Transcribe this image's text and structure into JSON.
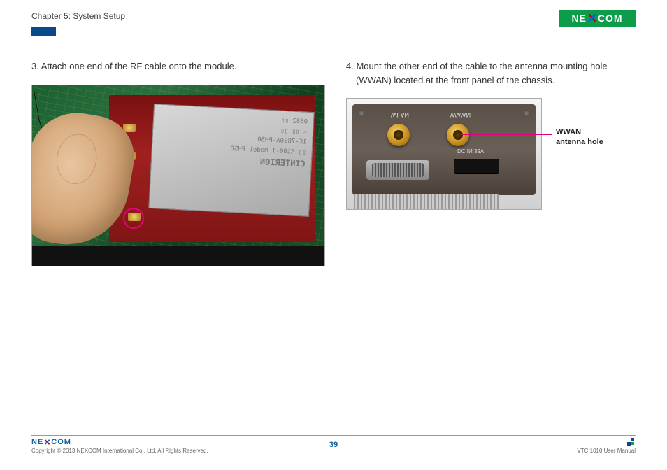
{
  "header": {
    "chapter": "Chapter 5: System Setup",
    "logo_text_left": "NE",
    "logo_text_right": "COM"
  },
  "steps": {
    "s3": "3. Attach one end of the RF cable onto the module.",
    "s4_line1": "4. Mount the other end of the cable to the antenna mounting hole",
    "s4_line2": "(WWAN) located at the front panel of the chassis."
  },
  "fig1": {
    "chip_lines": [
      "0682 ▯▯",
      "⚠ ▯▯ ▯▯",
      "1C-7830A-PH50",
      "▯▯-A100-1 Model PH50",
      "CINTERION"
    ]
  },
  "fig2": {
    "label_wlan": "WLAN",
    "label_wwan": "WWAN",
    "label_dc": "DC IN  36V",
    "callout_line1": "WWAN",
    "callout_line2": "antenna hole"
  },
  "footer": {
    "logo_left": "NE",
    "logo_right": "COM",
    "copyright": "Copyright © 2013 NEXCOM International Co., Ltd. All Rights Reserved.",
    "page": "39",
    "doc": "VTC 1010 User Manual"
  }
}
